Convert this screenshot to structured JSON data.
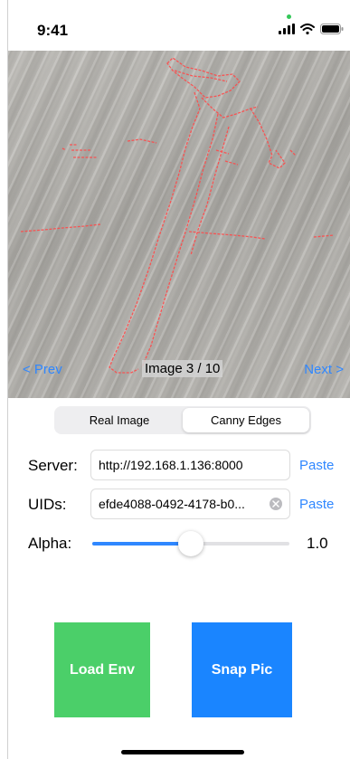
{
  "status": {
    "time": "9:41",
    "icons": [
      "signal-icon",
      "wifi-icon",
      "battery-icon"
    ]
  },
  "viewer": {
    "prev_label": "< Prev",
    "next_label": "Next >",
    "counter": "Image 3 / 10"
  },
  "mode_toggle": {
    "options": [
      "Real Image",
      "Canny Edges"
    ],
    "selected": "Canny Edges"
  },
  "form": {
    "server_label": "Server:",
    "server_value": "http://192.168.1.136:8000",
    "uids_label": "UIDs:",
    "uids_value": "efde4088-0492-4178-b0...",
    "paste_label": "Paste",
    "alpha_label": "Alpha:",
    "alpha_value": "1.0",
    "alpha_slider_fraction": 0.5
  },
  "actions": {
    "load_label": "Load Env",
    "snap_label": "Snap Pic"
  },
  "colors": {
    "accent": "#2f87ff",
    "load_button": "#4bcf69",
    "snap_button": "#1a85ff",
    "edge_overlay": "#ff4a4a"
  }
}
